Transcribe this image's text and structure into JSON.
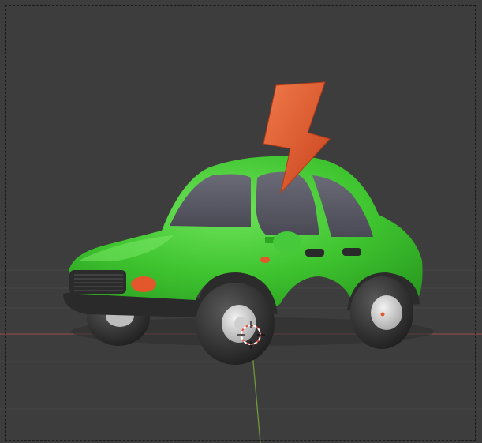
{
  "viewport": {
    "background_color": "#3d3d3d",
    "grid_color": "#4a4a4a",
    "x_axis_color": "#8a4a4a",
    "y_axis_color": "#6e9a3a",
    "border_style": "dashed"
  },
  "scene": {
    "objects": [
      {
        "name": "car-body",
        "color": "#3ec42f"
      },
      {
        "name": "lightning-bolt",
        "color": "#e2572c"
      },
      {
        "name": "tires",
        "color": "#2b2b2b"
      },
      {
        "name": "hubcaps",
        "color": "#d9d9d9"
      },
      {
        "name": "windows",
        "color": "#5a5a66"
      },
      {
        "name": "headlight",
        "color": "#e2572c"
      }
    ],
    "cursor_3d": "visible"
  }
}
